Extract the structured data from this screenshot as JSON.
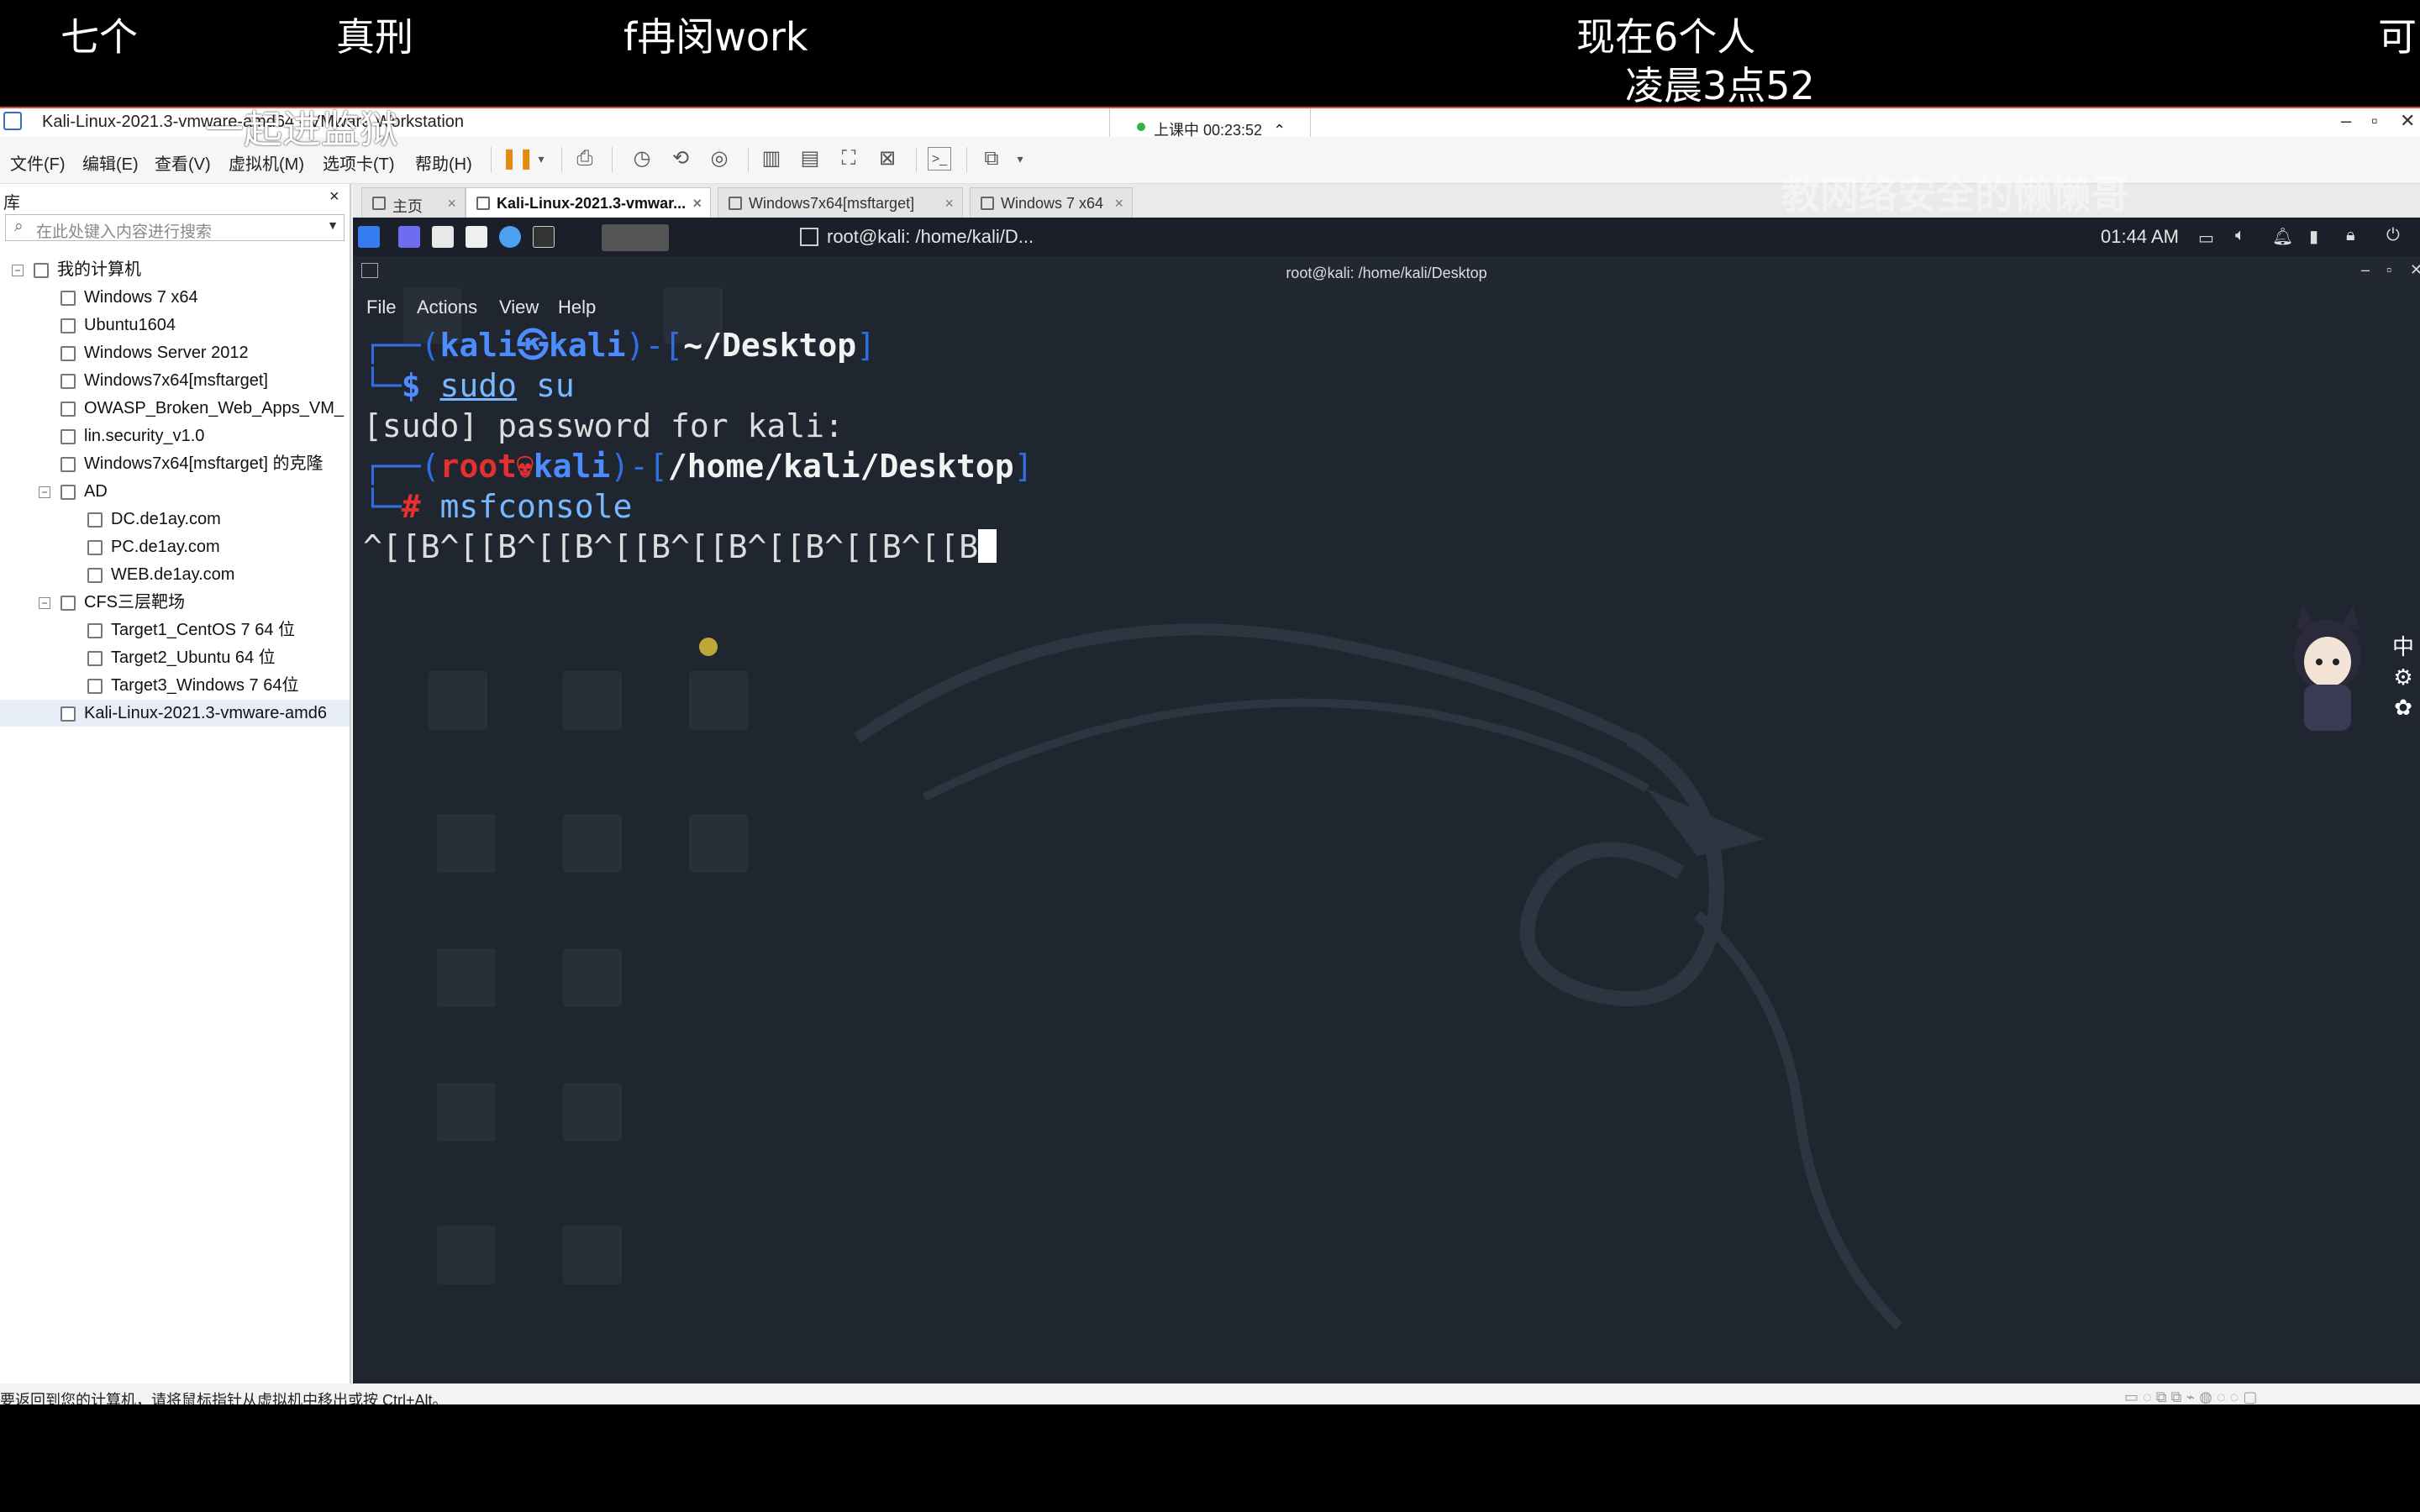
{
  "danmaku": [
    "七个",
    "真刑",
    "f冉闵work",
    "现在6个人",
    "可",
    "凌晨3点52",
    "一起进监狱"
  ],
  "vmware": {
    "title": "Kali-Linux-2021.3-vmware-amd64 - VMware Workstation",
    "recording_badge": "上课中 00:23:52",
    "menus": [
      "文件(F)",
      "编辑(E)",
      "查看(V)",
      "虚拟机(M)",
      "选项卡(T)",
      "帮助(H)"
    ],
    "library": {
      "header": "库",
      "close": "×",
      "search_placeholder": "在此处键入内容进行搜索",
      "tree": [
        {
          "label": "我的计算机",
          "level": 0,
          "expander": "⊟"
        },
        {
          "label": "Windows 7 x64",
          "level": 1
        },
        {
          "label": "Ubuntu1604",
          "level": 1
        },
        {
          "label": "Windows Server 2012",
          "level": 1
        },
        {
          "label": "Windows7x64[msftarget]",
          "level": 1
        },
        {
          "label": "OWASP_Broken_Web_Apps_VM_",
          "level": 1
        },
        {
          "label": "lin.security_v1.0",
          "level": 1
        },
        {
          "label": "Windows7x64[msftarget] 的克隆",
          "level": 1
        },
        {
          "label": "AD",
          "level": 1,
          "expander": "⊟"
        },
        {
          "label": "DC.de1ay.com",
          "level": 2
        },
        {
          "label": "PC.de1ay.com",
          "level": 2
        },
        {
          "label": "WEB.de1ay.com",
          "level": 2
        },
        {
          "label": "CFS三层靶场",
          "level": 1,
          "expander": "⊟"
        },
        {
          "label": "Target1_CentOS 7 64 位",
          "level": 2
        },
        {
          "label": "Target2_Ubuntu 64 位",
          "level": 2
        },
        {
          "label": "Target3_Windows 7 64位",
          "level": 2
        },
        {
          "label": "Kali-Linux-2021.3-vmware-amd6",
          "level": 1,
          "selected": true
        }
      ]
    },
    "tabs": [
      {
        "label": "主页",
        "active": false
      },
      {
        "label": "Kali-Linux-2021.3-vmwar...",
        "active": true
      },
      {
        "label": "Windows7x64[msftarget]",
        "active": false
      },
      {
        "label": "Windows 7 x64",
        "active": false
      }
    ],
    "status_text": "要返回到您的计算机，请将鼠标指针从虚拟机中移出或按 Ctrl+Alt。"
  },
  "kali": {
    "taskbar_window": "root@kali: /home/kali/D...",
    "clock": "01:44 AM",
    "terminal_title": "root@kali: /home/kali/Desktop",
    "terminal_menu": [
      "File",
      "Actions",
      "View",
      "Help"
    ],
    "prompt1": {
      "user": "kali",
      "host": "kali",
      "path": "~/Desktop",
      "sym": "$",
      "cmd_sudo": "sudo",
      "cmd_rest": " su"
    },
    "sudo_line": "[sudo] password for kali:",
    "prompt2": {
      "user": "root",
      "host": "kali",
      "path": "/home/kali/Desktop",
      "sym": "#",
      "cmd": "msfconsole"
    },
    "typed_line": "^[[B^[[B^[[B^[[B^[[B^[[B^[[B^[[B",
    "watermark": "教网络安全的懒懒哥"
  },
  "colors": {
    "accent_red": "#e04e3a",
    "kali_blue": "#2f6fe4",
    "root_red": "#e53030",
    "terminal_bg": "#20262f"
  }
}
